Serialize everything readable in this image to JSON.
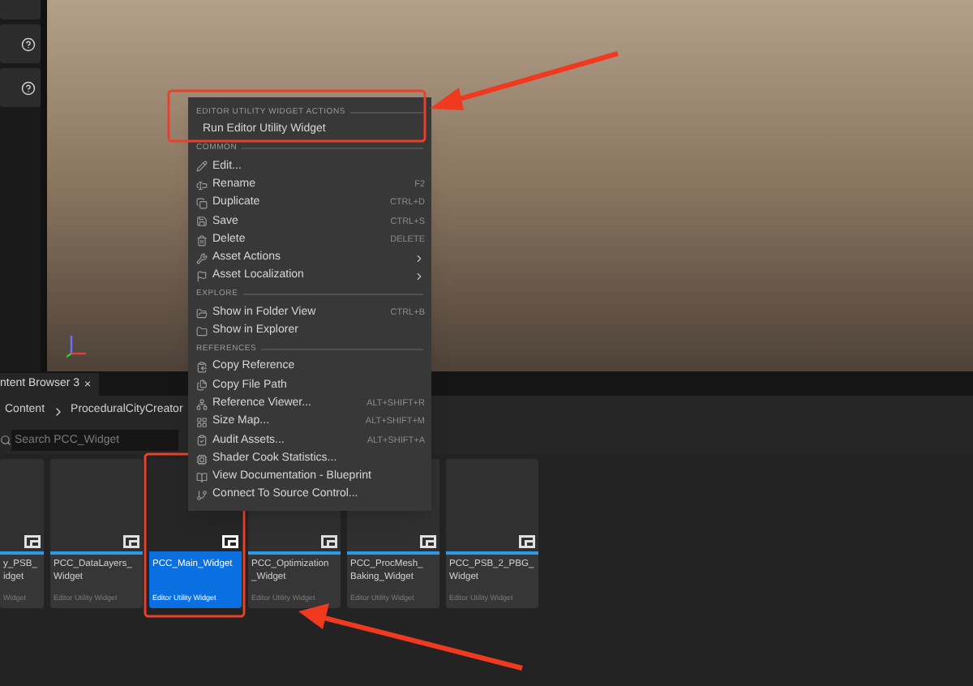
{
  "content_browser": {
    "tab": {
      "label": "ntent Browser 3",
      "close": "×"
    },
    "breadcrumb": [
      "Content",
      "ProceduralCityCreator"
    ],
    "search": {
      "placeholder": "Search PCC_Widget"
    },
    "assets": [
      {
        "name_lines": [
          "y_PSB_",
          "idget"
        ],
        "type": "Widget",
        "selected": false
      },
      {
        "name_lines": [
          "PCC_DataLayers_",
          "Widget"
        ],
        "type": "Editor Utility Widget",
        "selected": false
      },
      {
        "name_lines": [
          "PCC_Main_Widget"
        ],
        "type": "Editor Utility Widget",
        "selected": true
      },
      {
        "name_lines": [
          "PCC_Optimization",
          "_Widget"
        ],
        "type": "Editor Utility Widget",
        "selected": false
      },
      {
        "name_lines": [
          "PCC_ProcMesh_",
          "Baking_Widget"
        ],
        "type": "Editor Utility Widget",
        "selected": false
      },
      {
        "name_lines": [
          "PCC_PSB_2_PBG_",
          "Widget"
        ],
        "type": "Editor Utility Widget",
        "selected": false
      }
    ]
  },
  "context_menu": {
    "sections": [
      {
        "header": "EDITOR UTILITY WIDGET ACTIONS",
        "items": [
          {
            "label": "Run Editor Utility Widget",
            "submenu": false
          }
        ]
      },
      {
        "header": "COMMON",
        "items": [
          {
            "label": "Edit...",
            "submenu": false
          },
          {
            "label": "Rename",
            "shortcut": "F2",
            "submenu": false
          },
          {
            "label": "Duplicate",
            "shortcut": "CTRL+D",
            "submenu": false
          },
          {
            "label": "Save",
            "shortcut": "CTRL+S",
            "submenu": false
          },
          {
            "label": "Delete",
            "shortcut": "DELETE",
            "submenu": false
          },
          {
            "label": "Asset Actions",
            "submenu": true
          },
          {
            "label": "Asset Localization",
            "submenu": true
          }
        ]
      },
      {
        "header": "EXPLORE",
        "items": [
          {
            "label": "Show in Folder View",
            "shortcut": "CTRL+B",
            "submenu": false
          },
          {
            "label": "Show in Explorer",
            "submenu": false
          }
        ]
      },
      {
        "header": "REFERENCES",
        "items": [
          {
            "label": "Copy Reference",
            "submenu": false
          },
          {
            "label": "Copy File Path",
            "submenu": false
          },
          {
            "label": "Reference Viewer...",
            "shortcut": "ALT+SHIFT+R",
            "submenu": false
          },
          {
            "label": "Size Map...",
            "shortcut": "ALT+SHIFT+M",
            "submenu": false
          },
          {
            "label": "Audit Assets...",
            "shortcut": "ALT+SHIFT+A",
            "submenu": false
          },
          {
            "label": "Shader Cook Statistics...",
            "submenu": false
          },
          {
            "label": "View Documentation - Blueprint",
            "submenu": false
          },
          {
            "label": "Connect To Source Control...",
            "submenu": false
          }
        ]
      }
    ]
  }
}
